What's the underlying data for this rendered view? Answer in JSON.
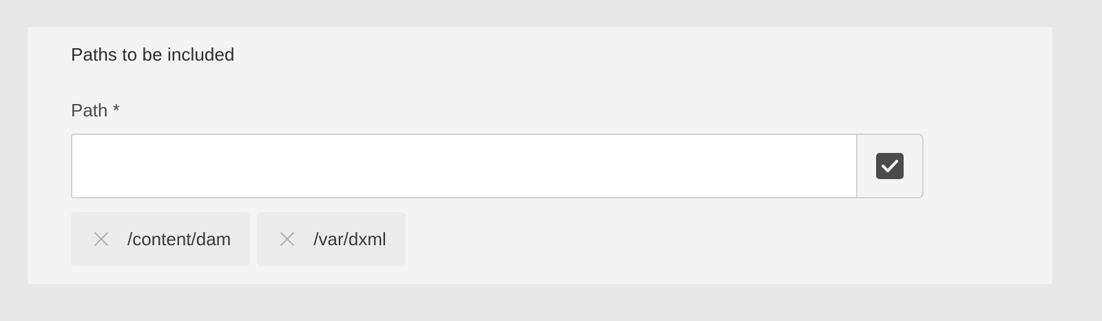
{
  "section": {
    "heading": "Paths to be included"
  },
  "path_field": {
    "label": "Path *",
    "value": "",
    "placeholder": ""
  },
  "confirm_button": {
    "icon": "checkbox-checked-icon"
  },
  "tags": [
    {
      "label": "/content/dam",
      "remove_icon": "close-icon"
    },
    {
      "label": "/var/dxml",
      "remove_icon": "close-icon"
    }
  ],
  "colors": {
    "page_background": "#e8e8e8",
    "panel_background": "#f4f4f4",
    "input_border": "#d3d3d3",
    "check_fill": "#4b4b4b",
    "tag_background": "#ececec"
  }
}
